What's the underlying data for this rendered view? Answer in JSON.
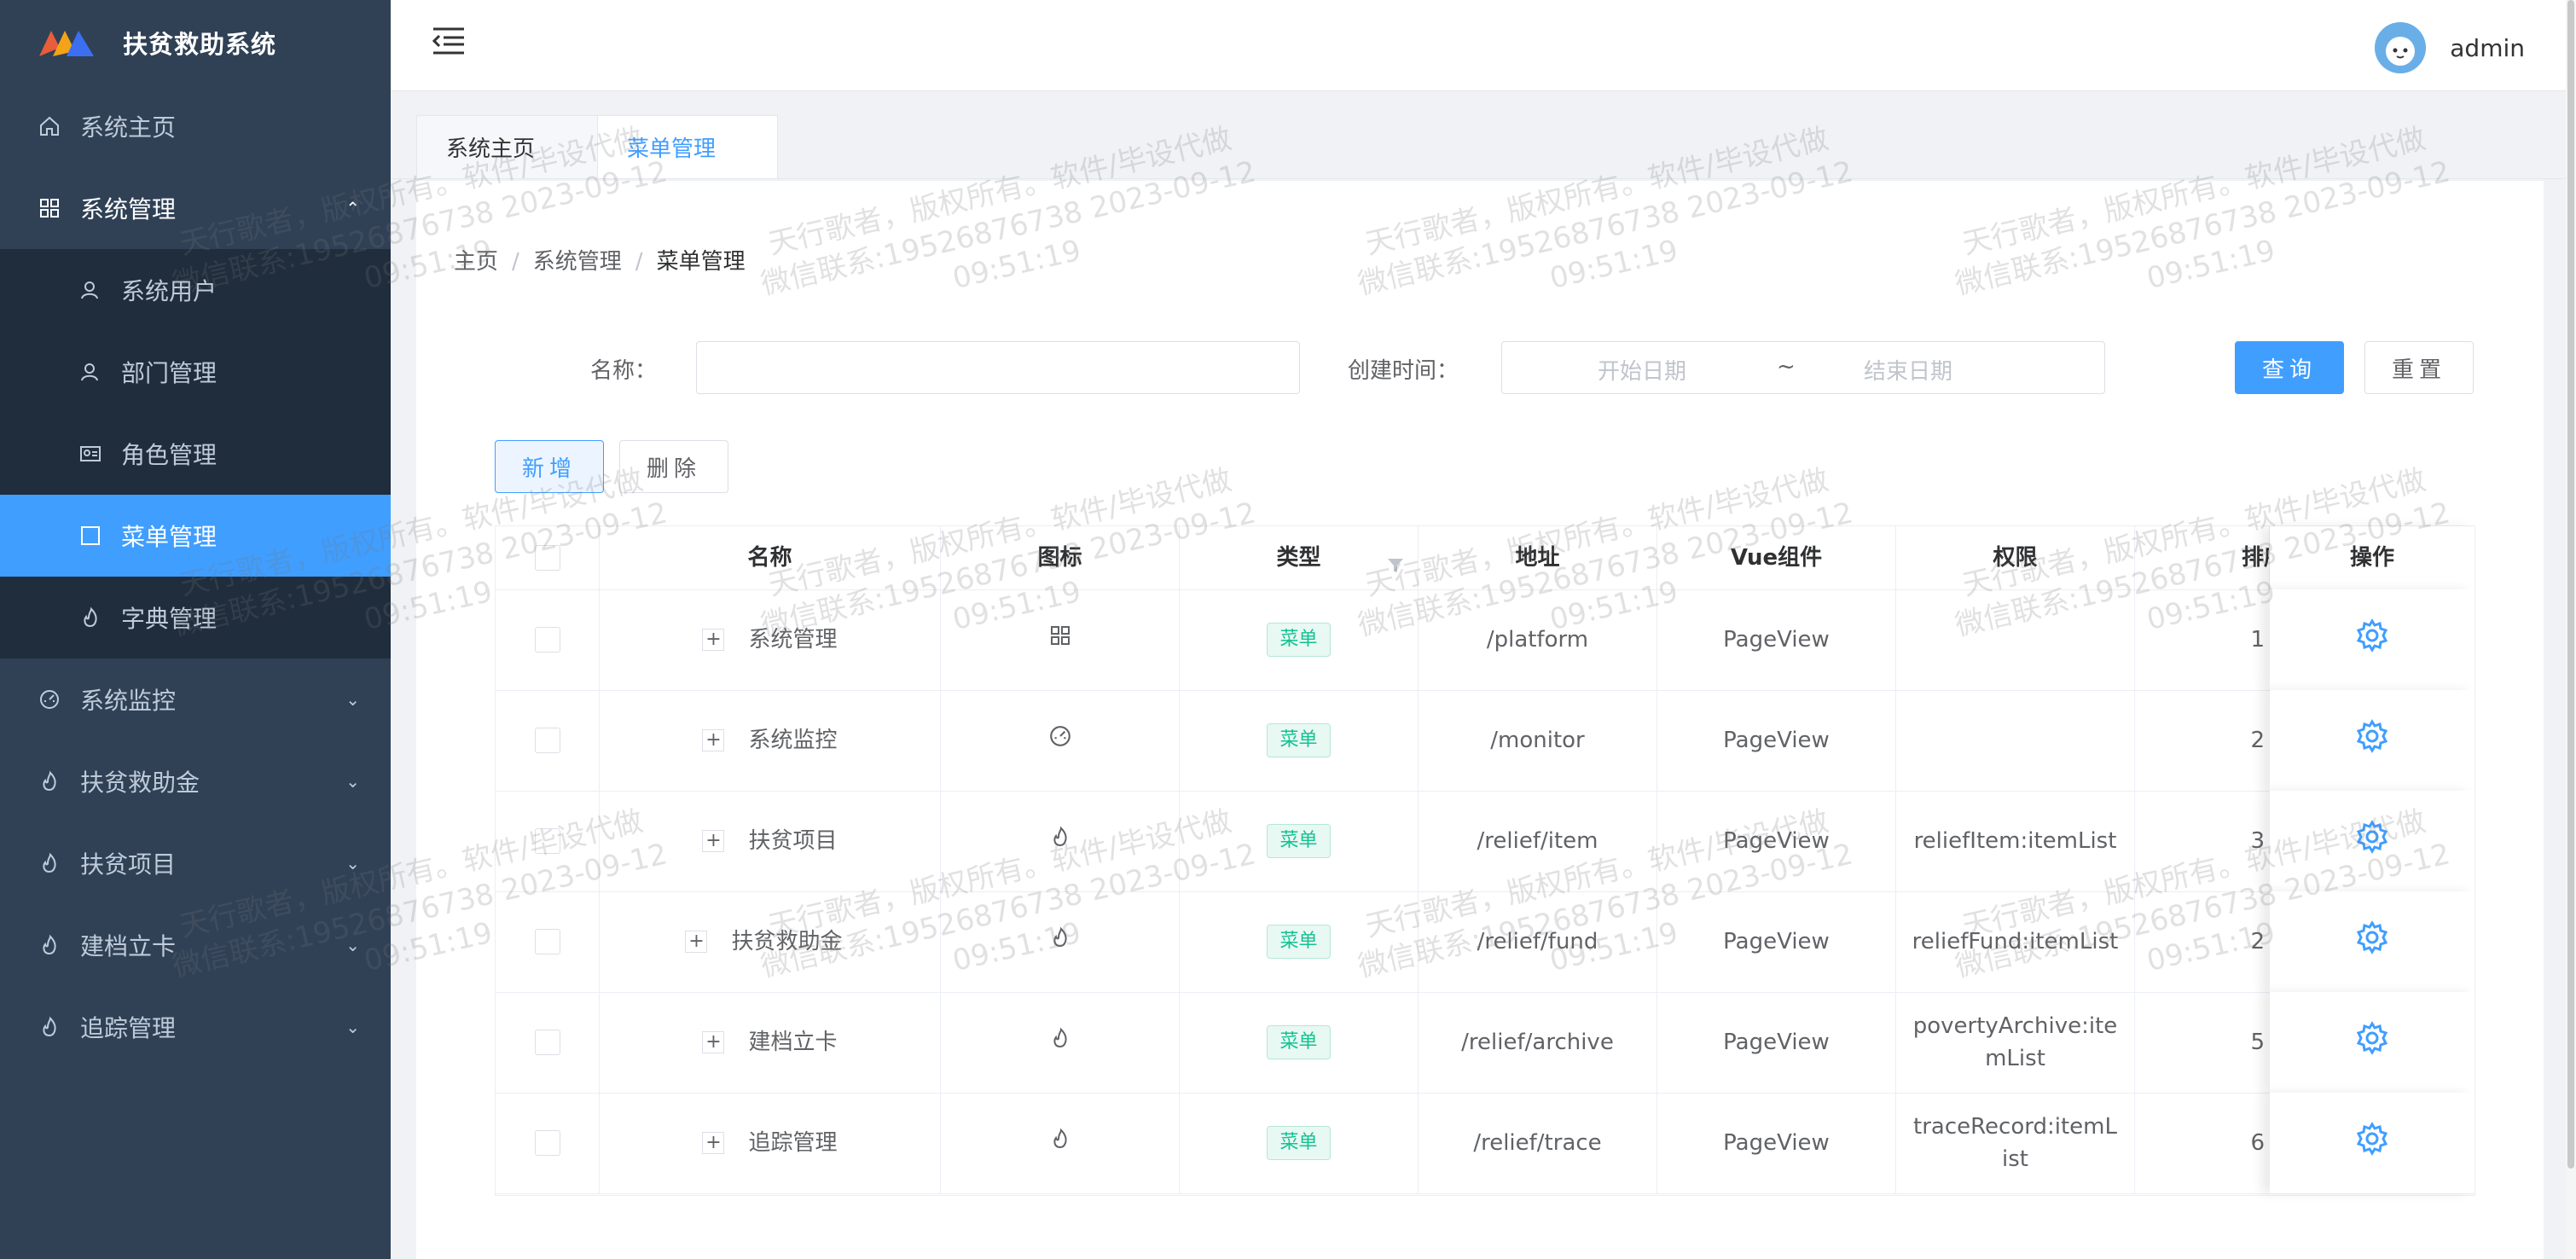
{
  "app": {
    "title": "扶贫救助系统"
  },
  "sidebar": {
    "items": [
      {
        "label": "系统主页",
        "icon": "home-icon"
      },
      {
        "label": "系统管理",
        "icon": "grid-icon",
        "expanded": true,
        "children": [
          {
            "label": "系统用户",
            "icon": "user-icon"
          },
          {
            "label": "部门管理",
            "icon": "user-icon"
          },
          {
            "label": "角色管理",
            "icon": "id-card-icon"
          },
          {
            "label": "菜单管理",
            "icon": "square-icon",
            "active": true
          },
          {
            "label": "字典管理",
            "icon": "flame-icon"
          }
        ]
      },
      {
        "label": "系统监控",
        "icon": "dashboard-icon"
      },
      {
        "label": "扶贫救助金",
        "icon": "flame-icon"
      },
      {
        "label": "扶贫项目",
        "icon": "flame-icon"
      },
      {
        "label": "建档立卡",
        "icon": "flame-icon"
      },
      {
        "label": "追踪管理",
        "icon": "flame-icon"
      }
    ]
  },
  "header": {
    "username": "admin"
  },
  "tabs": [
    {
      "label": "系统主页"
    },
    {
      "label": "菜单管理",
      "active": true
    }
  ],
  "breadcrumb": {
    "home": "主页",
    "parent": "系统管理",
    "current": "菜单管理",
    "separator": "/"
  },
  "search": {
    "name_label": "名称：",
    "name_value": "",
    "time_label": "创建时间：",
    "start_placeholder": "开始日期",
    "range_sep": "~",
    "end_placeholder": "结束日期",
    "query_button": "查询",
    "reset_button": "重置"
  },
  "toolbar": {
    "add_button": "新增",
    "delete_button": "删除"
  },
  "table": {
    "columns": [
      "名称",
      "图标",
      "类型",
      "地址",
      "Vue组件",
      "权限",
      "排序",
      "操作"
    ],
    "rows": [
      {
        "name": "系统管理",
        "icon": "grid-icon",
        "type": "菜单",
        "path": "/platform",
        "component": "PageView",
        "permission": "",
        "sort": "1"
      },
      {
        "name": "系统监控",
        "icon": "dashboard-icon",
        "type": "菜单",
        "path": "/monitor",
        "component": "PageView",
        "permission": "",
        "sort": "2"
      },
      {
        "name": "扶贫项目",
        "icon": "flame-icon",
        "type": "菜单",
        "path": "/relief/item",
        "component": "PageView",
        "permission": "reliefItem:itemList",
        "sort": "3"
      },
      {
        "name": "扶贫救助金",
        "icon": "flame-icon",
        "type": "菜单",
        "path": "/relief/fund",
        "component": "PageView",
        "permission": "reliefFund:itemList",
        "sort": "2"
      },
      {
        "name": "建档立卡",
        "icon": "flame-icon",
        "type": "菜单",
        "path": "/relief/archive",
        "component": "PageView",
        "permission": "povertyArchive:itemList",
        "sort": "5"
      },
      {
        "name": "追踪管理",
        "icon": "flame-icon",
        "type": "菜单",
        "path": "/relief/trace",
        "component": "PageView",
        "permission": "traceRecord:itemList",
        "sort": "6"
      }
    ]
  },
  "watermark": {
    "line1": "天行歌者，版权所有。软件/毕设代做",
    "line2": "微信联系:19526876738 2023-09-12",
    "line3": "09:51:19"
  },
  "colors": {
    "sidebar_bg": "#304156",
    "submenu_bg": "#1f2d3d",
    "accent": "#409eff",
    "tag_green": "#13c291"
  }
}
